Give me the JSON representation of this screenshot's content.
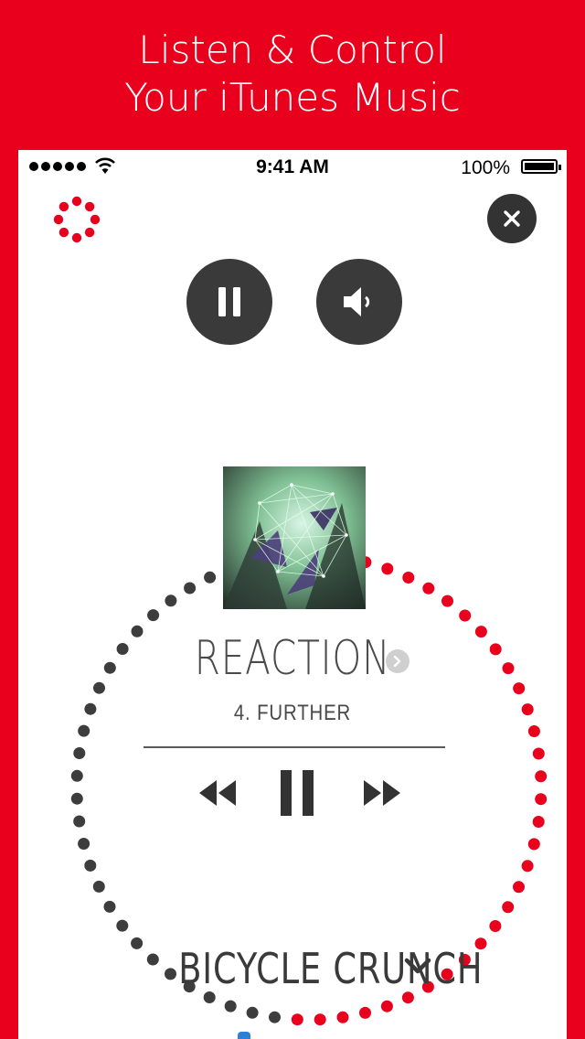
{
  "promo": {
    "line1": "Listen & Control",
    "line2": "Your iTunes Music"
  },
  "status_bar": {
    "time": "9:41 AM",
    "battery": "100%",
    "signal_icon": "signal-dots-icon",
    "wifi_icon": "wifi-icon"
  },
  "header": {
    "logo_icon": "dotted-ring-logo-icon",
    "close_icon": "close-icon"
  },
  "quick_controls": {
    "pause_icon": "pause-icon",
    "speaker_icon": "speaker-icon"
  },
  "now_playing": {
    "title": "REACTION",
    "track": "4. FURTHER",
    "progress": 0.52,
    "album_art_icon": "album-art"
  },
  "transport": {
    "prev_icon": "rewind-icon",
    "play_icon": "pause-icon",
    "next_icon": "fast-forward-icon"
  },
  "workout": {
    "label": "BICYCLE CRUNCH",
    "chevron_icon": "chevron-down-icon"
  },
  "colors": {
    "accent": "#e8001c",
    "dark": "#3a3a3a",
    "dot_played": "#e8001c",
    "dot_remaining": "#3d3d3d"
  }
}
